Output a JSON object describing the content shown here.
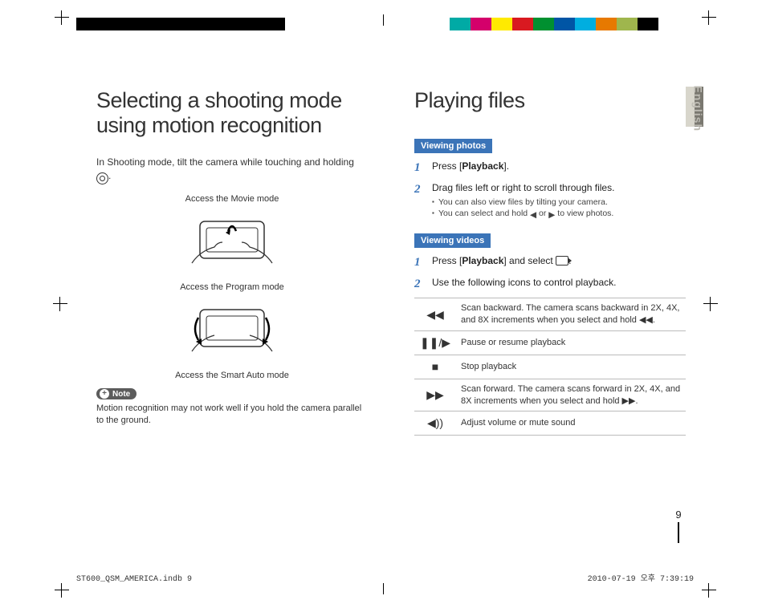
{
  "meta": {
    "language_tab": "English",
    "page_number": "9",
    "footer_left": "ST600_QSM_AMERICA.indb   9",
    "footer_right": "2010-07-19   오후 7:39:19"
  },
  "left": {
    "heading": "Selecting a shooting mode using motion recognition",
    "intro_pre": "In Shooting mode, tilt the camera while touching and holding ",
    "intro_post": ".",
    "caption1": "Access the Movie mode",
    "caption2": "Access the Program mode",
    "caption3": "Access the Smart Auto mode",
    "note_label": "Note",
    "note_text": "Motion recognition may not work well if you hold the camera parallel to the ground."
  },
  "right": {
    "heading": "Playing files",
    "section_photos": "Viewing photos",
    "photos_step1_pre": "Press [",
    "photos_step1_bold": "Playback",
    "photos_step1_post": "].",
    "photos_step2": "Drag files left or right to scroll through files.",
    "photos_sub1": "You can also view files by tilting your camera.",
    "photos_sub2_pre": "You can select and hold ",
    "photos_sub2_mid": " or ",
    "photos_sub2_post": " to view photos.",
    "section_videos": "Viewing videos",
    "videos_step1_pre": "Press [",
    "videos_step1_bold": "Playback",
    "videos_step1_mid": "] and select ",
    "videos_step1_post": ".",
    "videos_step2": "Use the following icons to control playback.",
    "table": {
      "row1": "Scan backward. The camera scans backward in 2X, 4X, and 8X increments when you select and hold ◀◀.",
      "row2": "Pause or resume playback",
      "row3": "Stop playback",
      "row4": "Scan forward. The camera scans forward in 2X, 4X, and 8X increments when you select and hold ▶▶.",
      "row5": "Adjust volume or mute sound"
    },
    "color_bar": [
      "#00aaa5",
      "#d4006b",
      "#ffea00",
      "#d91920",
      "#009030",
      "#0055a5",
      "#00aee0",
      "#e77900",
      "#9fb64d",
      "#000000"
    ]
  }
}
